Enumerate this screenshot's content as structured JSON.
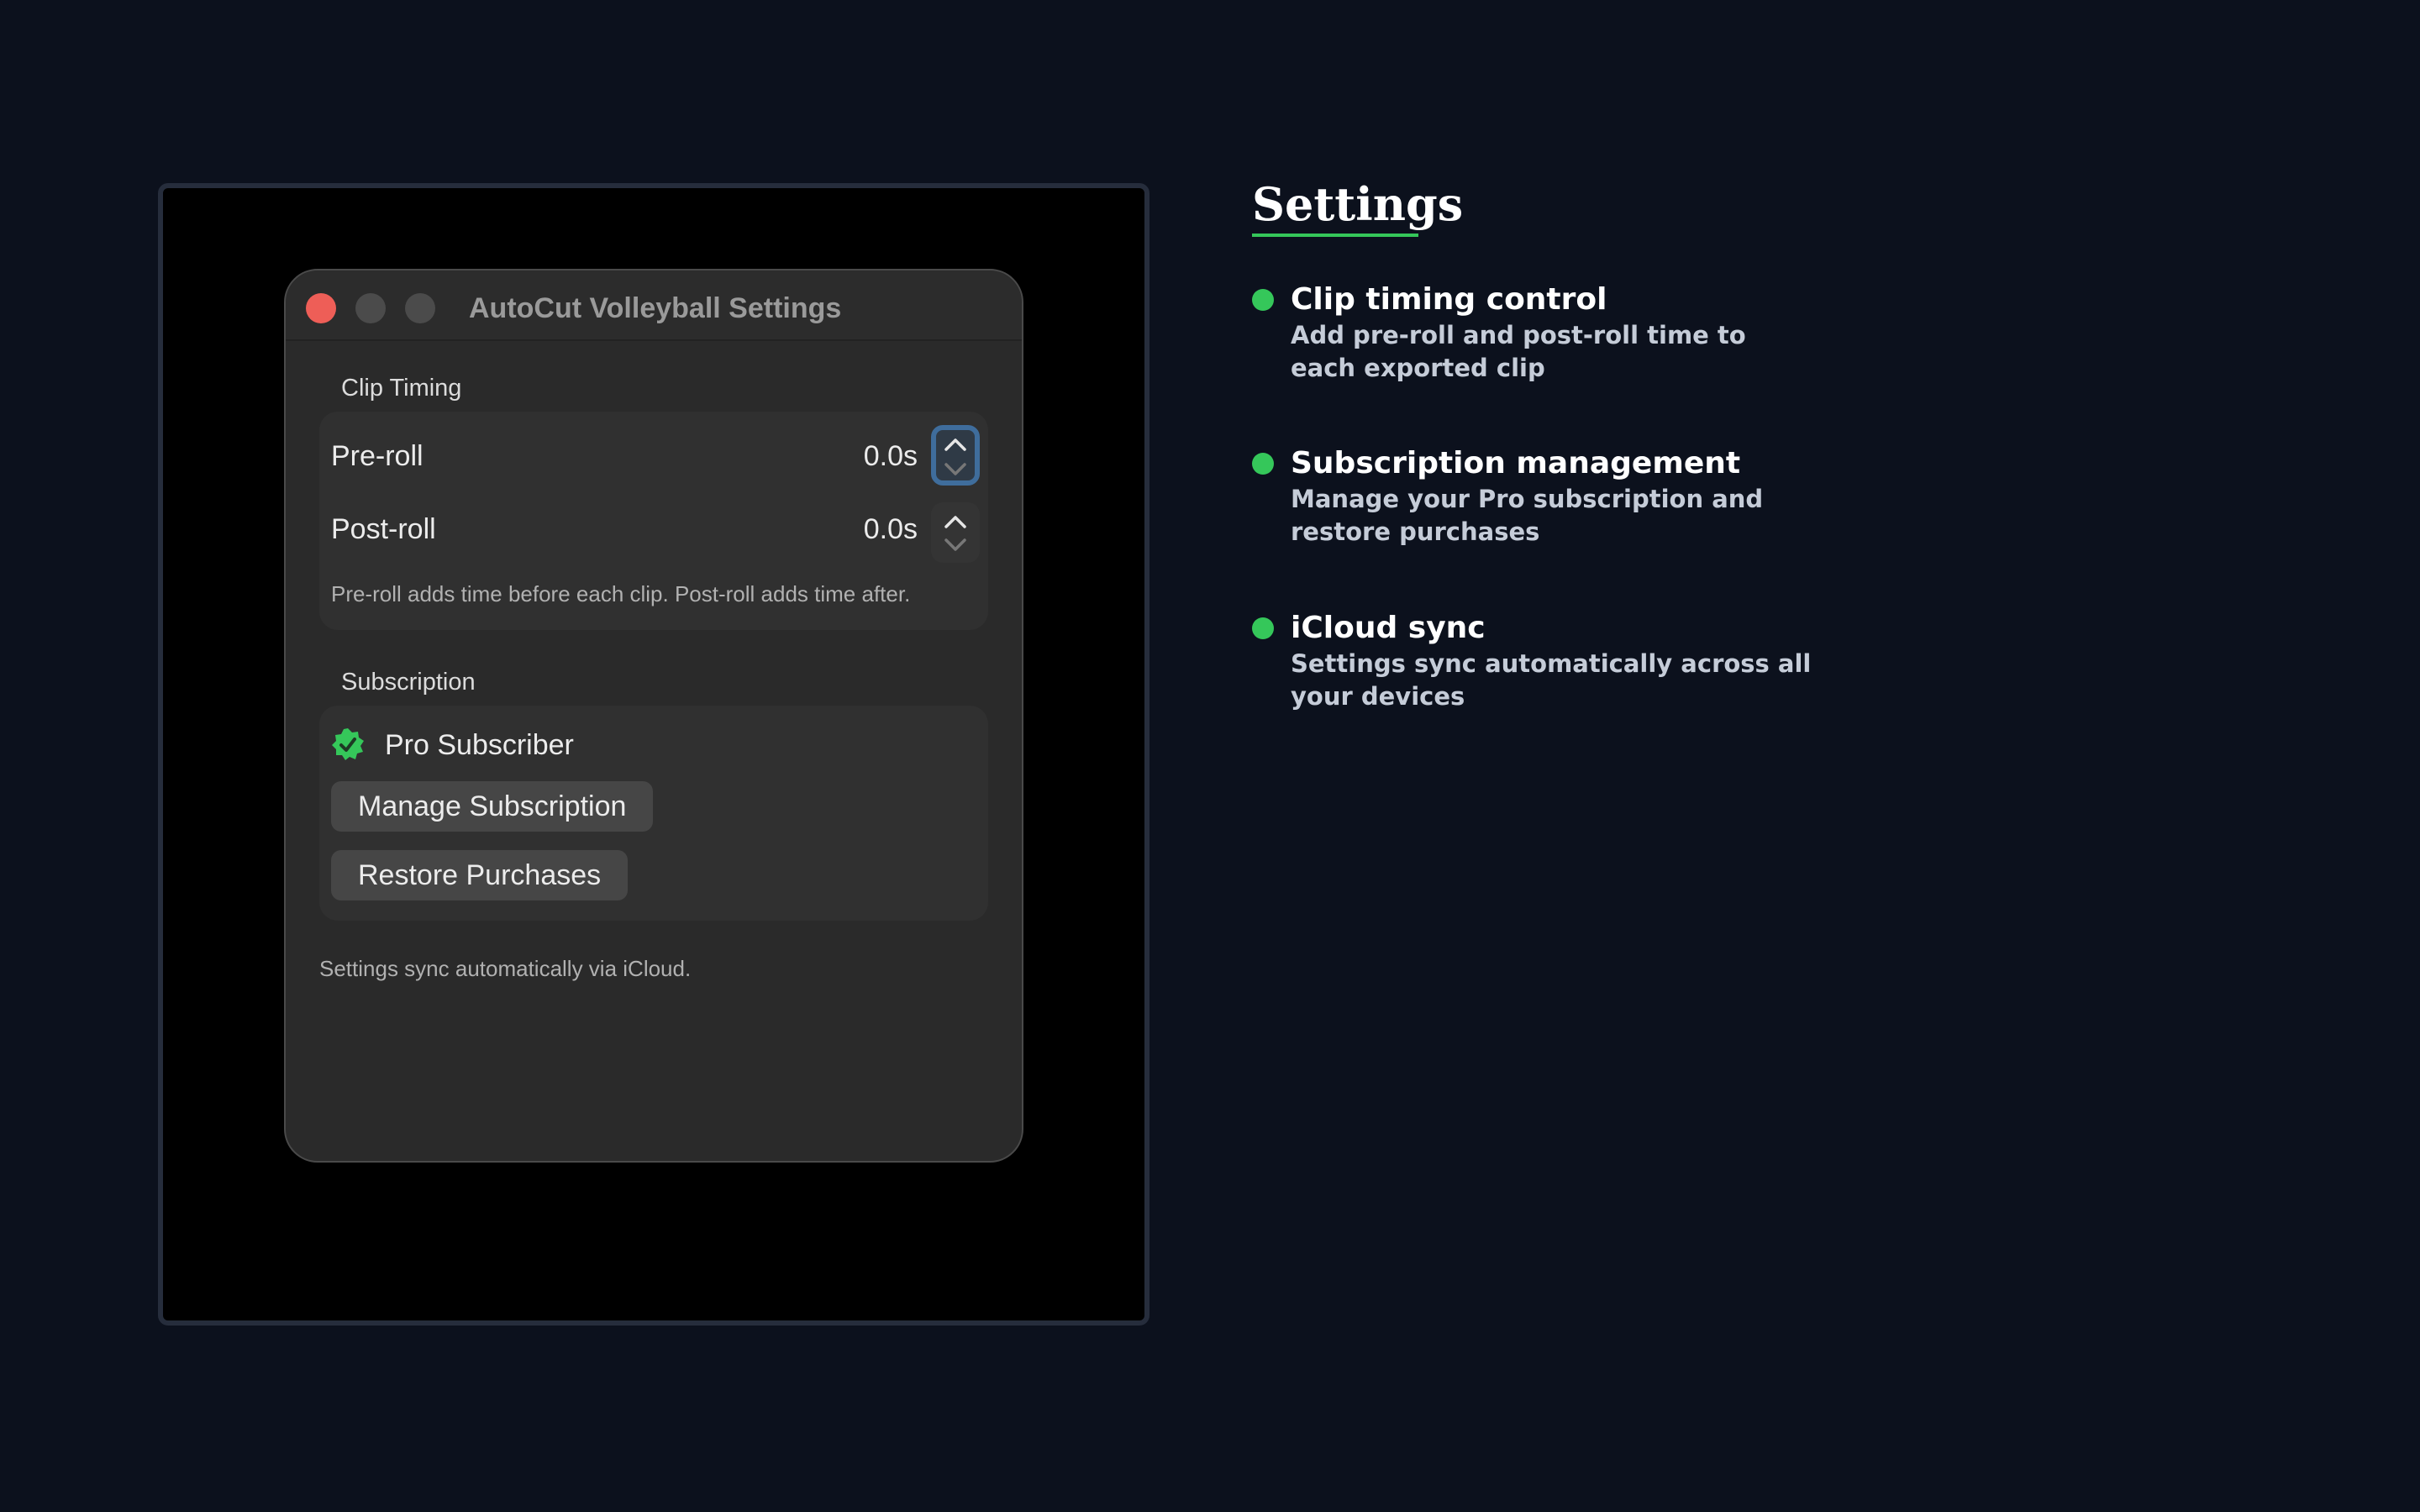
{
  "window": {
    "title": "AutoCut Volleyball Settings"
  },
  "clip_timing": {
    "section_label": "Clip Timing",
    "pre_roll": {
      "label": "Pre-roll",
      "value": "0.0s"
    },
    "post_roll": {
      "label": "Post-roll",
      "value": "0.0s"
    },
    "helper_text": "Pre-roll adds time before each clip. Post-roll adds time after."
  },
  "subscription": {
    "section_label": "Subscription",
    "status": "Pro Subscriber",
    "manage_button": "Manage Subscription",
    "restore_button": "Restore Purchases"
  },
  "footer_note": "Settings sync automatically via iCloud.",
  "panel": {
    "title": "Settings",
    "features": [
      {
        "title": "Clip timing control",
        "description": "Add pre-roll and post-roll time to each exported clip"
      },
      {
        "title": "Subscription management",
        "description": "Manage your Pro subscription and restore purchases"
      },
      {
        "title": "iCloud sync",
        "description": "Settings sync automatically across all your devices"
      }
    ]
  },
  "colors": {
    "background": "#0c111d",
    "accent_green": "#35c75a",
    "close_button": "#ee5e57",
    "focus_ring": "#3f6d9c"
  }
}
